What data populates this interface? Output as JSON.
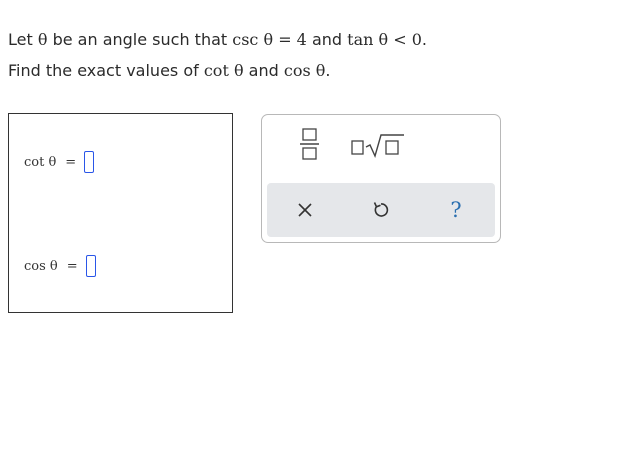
{
  "problem": {
    "line1": {
      "t1": "Let ",
      "m1": "θ",
      "t2": " be an angle such that ",
      "m2": "csc θ = 4",
      "t3": " and ",
      "m3": "tan θ < 0",
      "t4": "."
    },
    "line2": {
      "t1": "Find the exact values of ",
      "m1": "cot θ",
      "t2": " and ",
      "m2": "cos θ",
      "t3": "."
    }
  },
  "answers": [
    {
      "label": "cot θ",
      "equals": "=",
      "value": ""
    },
    {
      "label": "cos θ",
      "equals": "=",
      "value": ""
    }
  ],
  "palette": {
    "tools": [
      "fraction-icon",
      "sqrt-icon"
    ],
    "actions": {
      "clear": "close-icon",
      "undo": "undo-icon",
      "help": "?"
    }
  },
  "colors": {
    "input_border": "#2a56e8",
    "help_blue": "#2a6fb0",
    "action_bar_bg": "#e5e7ea"
  }
}
